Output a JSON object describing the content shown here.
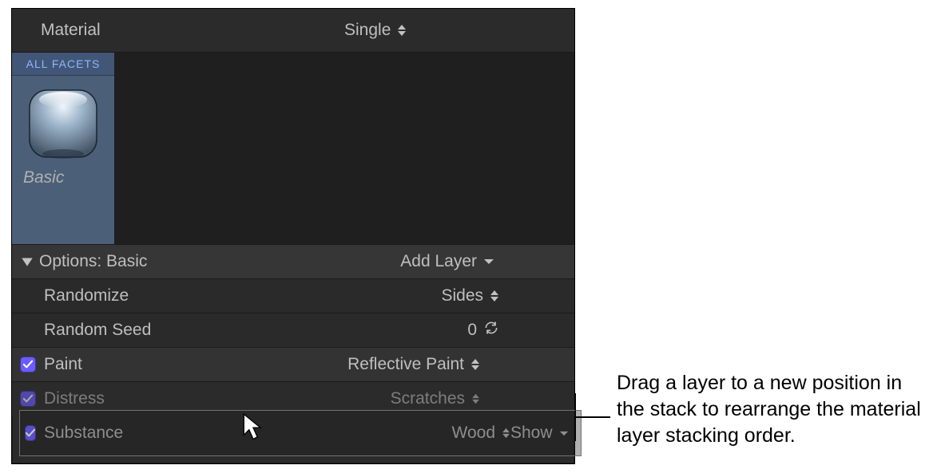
{
  "header": {
    "label": "Material",
    "mode": "Single"
  },
  "facet": {
    "tab": "ALL FACETS",
    "name": "Basic"
  },
  "section": {
    "title": "Options: Basic",
    "add_layer": "Add Layer"
  },
  "params": {
    "randomize_label": "Randomize",
    "randomize_value": "Sides",
    "seed_label": "Random Seed",
    "seed_value": "0"
  },
  "layers": {
    "paint": {
      "label": "Paint",
      "value": "Reflective Paint"
    },
    "distress": {
      "label": "Distress",
      "value": "Scratches"
    },
    "substance": {
      "label": "Substance",
      "value": "Wood",
      "show": "Show"
    }
  },
  "annotation": "Drag a layer to a new position in the stack to rearrange the material layer stacking order."
}
